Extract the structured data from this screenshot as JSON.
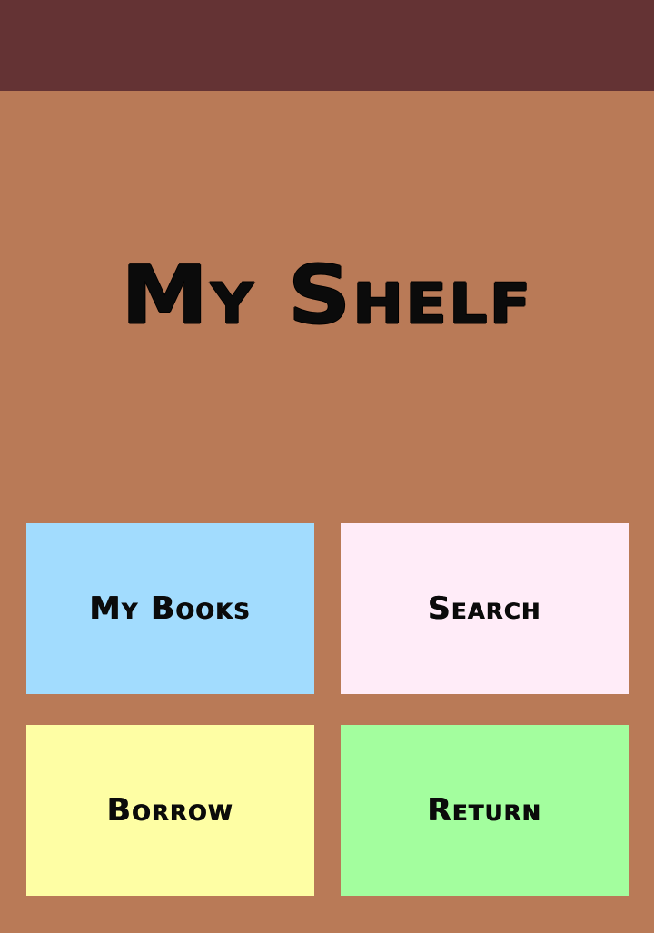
{
  "header": {
    "color": "#643334"
  },
  "app": {
    "title": "My Shelf",
    "background": "#b97a57"
  },
  "menu": {
    "my_books": {
      "label": "My Books",
      "color": "#a2dcfe"
    },
    "search": {
      "label": "Search",
      "color": "#ffecf8"
    },
    "borrow": {
      "label": "Borrow",
      "color": "#fefea4"
    },
    "return": {
      "label": "Return",
      "color": "#a3fe9e"
    }
  }
}
